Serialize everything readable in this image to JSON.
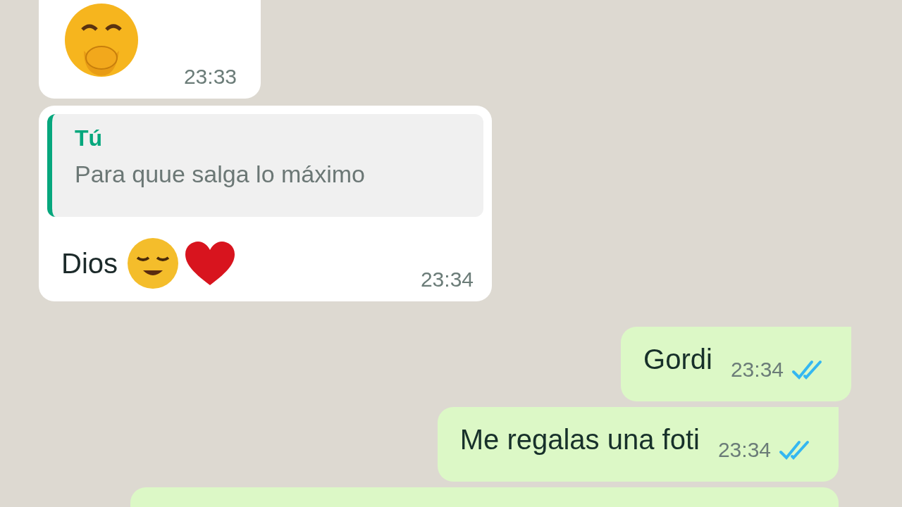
{
  "messages": [
    {
      "kind": "emoji",
      "outgoing": false,
      "time": "23:33"
    },
    {
      "kind": "reply",
      "outgoing": false,
      "quote_author": "Tú",
      "quote_text": "Para quue salga lo máximo",
      "text": "Dios",
      "time": "23:34"
    },
    {
      "kind": "text",
      "outgoing": true,
      "text": "Gordi",
      "time": "23:34",
      "read": true
    },
    {
      "kind": "text",
      "outgoing": true,
      "text": "Me regalas una foti",
      "time": "23:34",
      "read": true
    },
    {
      "kind": "partial",
      "outgoing": true
    }
  ]
}
